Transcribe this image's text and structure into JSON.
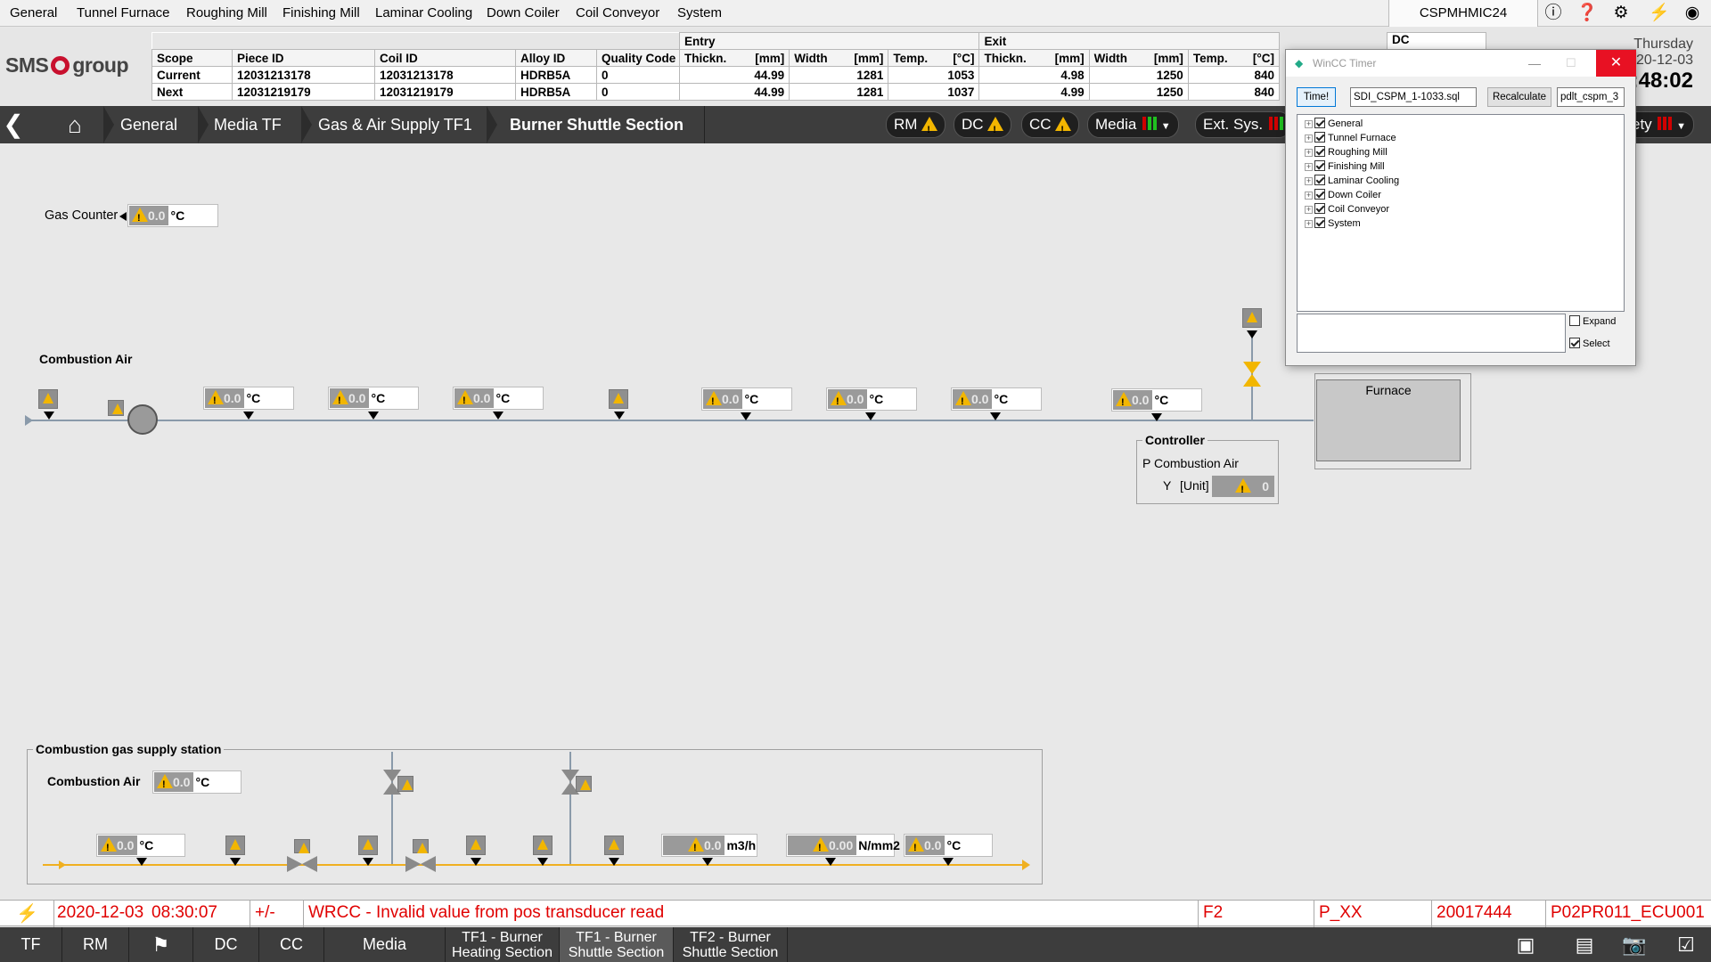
{
  "top_menu": {
    "items": [
      "General",
      "Tunnel Furnace",
      "Roughing Mill",
      "Finishing Mill",
      "Laminar Cooling",
      "Down Coiler",
      "Coil Conveyor",
      "System"
    ],
    "host": "CSPMHMIC24"
  },
  "logo": {
    "text_a": "SMS",
    "text_b": "group"
  },
  "piece_table": {
    "header": {
      "scope": "Scope",
      "piece_id": "Piece ID",
      "coil_id": "Coil ID",
      "alloy_id": "Alloy ID",
      "quality": "Quality Code",
      "entry": "Entry",
      "exit": "Exit",
      "dc": "DC",
      "thick": "Thickn.",
      "mm": "[mm]",
      "width": "Width",
      "temp": "Temp.",
      "degc": "[°C]"
    },
    "rows": [
      {
        "scope": "Current",
        "piece_id": "12031213178",
        "coil_id": "12031213178",
        "alloy_id": "HDRB5A",
        "quality": "0",
        "en_thick": "44.99",
        "en_width": "1281",
        "en_temp": "1053",
        "ex_thick": "4.98",
        "ex_width": "1250",
        "ex_temp": "840"
      },
      {
        "scope": "Next",
        "piece_id": "12031219179",
        "coil_id": "12031219179",
        "alloy_id": "HDRB5A",
        "quality": "0",
        "en_thick": "44.99",
        "en_width": "1281",
        "en_temp": "1037",
        "ex_thick": "4.99",
        "ex_width": "1250",
        "ex_temp": "840"
      }
    ]
  },
  "datetime": {
    "day": "Thursday",
    "date": "20-12-03",
    "time": "3:48:02"
  },
  "breadcrumb": [
    "General",
    "Media TF",
    "Gas & Air Supply TF1",
    "Burner Shuttle Section"
  ],
  "nav_buttons": {
    "rm": "RM",
    "dc": "DC",
    "cc": "CC",
    "media": "Media",
    "ext": "Ext. Sys.",
    "safety": "ety"
  },
  "colors": {
    "warning": "#f2b600",
    "alarm_text": "#e00000",
    "nav_bg": "#3d3d3d",
    "pipe_air": "#8a9aaa",
    "pipe_gas": "#f0b020"
  },
  "process": {
    "gas_counter": {
      "label": "Gas Counter",
      "value": "0.0",
      "unit": "°C"
    },
    "combustion_air_title": "Combustion Air",
    "air_values": [
      {
        "value": "0.0",
        "unit": "°C"
      },
      {
        "value": "0.0",
        "unit": "°C"
      },
      {
        "value": "0.0",
        "unit": "°C"
      },
      {
        "value": "0.0",
        "unit": "°C"
      },
      {
        "value": "0.0",
        "unit": "°C"
      },
      {
        "value": "0.0",
        "unit": "°C"
      },
      {
        "value": "0.0",
        "unit": "°C"
      }
    ],
    "furnace_label": "Furnace",
    "controller": {
      "title": "Controller",
      "name": "P Combustion Air",
      "y_label": "Y",
      "unit": "[Unit]",
      "value": "0"
    },
    "gas_station": {
      "title": "Combustion gas supply station",
      "air_label": "Combustion Air",
      "air_value": {
        "value": "0.0",
        "unit": "°C"
      },
      "line_values": [
        {
          "value": "0.0",
          "unit": "°C"
        },
        {
          "value": "0.0",
          "unit": "m3/h"
        },
        {
          "value": "0.00",
          "unit": "N/mm2"
        },
        {
          "value": "0.0",
          "unit": "°C"
        }
      ]
    }
  },
  "dialog": {
    "title": "WinCC Timer",
    "time_button": "Time!",
    "file": "SDI_CSPM_1-1033.sql",
    "recalc": "Recalculate",
    "field2": "pdlt_cspm_3",
    "tree": [
      "General",
      "Tunnel Furnace",
      "Roughing Mill",
      "Finishing Mill",
      "Laminar Cooling",
      "Down Coiler",
      "Coil Conveyor",
      "System"
    ],
    "expand": "Expand",
    "select": "Select"
  },
  "status": {
    "date": "2020-12-03",
    "time": "08:30:07",
    "sign": "+/-",
    "message": "WRCC - Invalid value from pos transducer read",
    "code": "F2",
    "p": "P_XX",
    "id": "20017444",
    "module": "P02PR011_ECU001"
  },
  "bottom": {
    "tabs": [
      "TF",
      "RM",
      "DC",
      "CC",
      "Media"
    ],
    "screen1_a": "TF1 - Burner",
    "screen1_b": "Heating Section",
    "screen2_a": "TF1 - Burner",
    "screen2_b": "Shuttle Section",
    "screen3_a": "TF2 - Burner",
    "screen3_b": "Shuttle Section"
  }
}
